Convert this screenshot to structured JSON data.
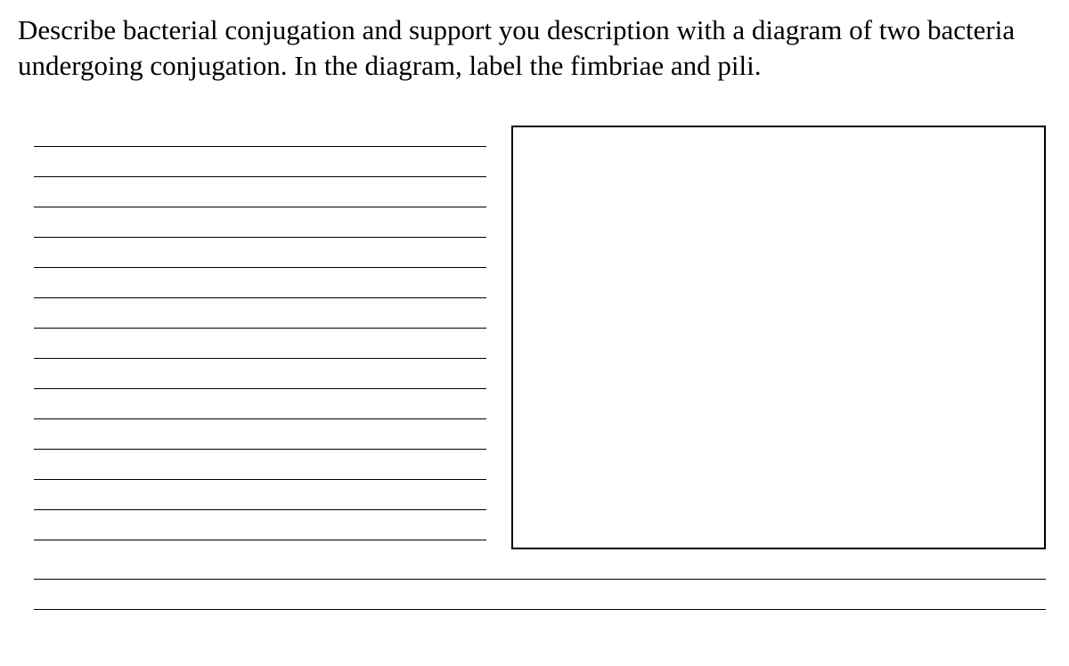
{
  "question": {
    "prompt": "Describe bacterial conjugation and support you description with a diagram of two bacteria undergoing conjugation. In the diagram, label the fimbriae and pili."
  },
  "layout": {
    "left_line_count": 14,
    "bottom_line_count": 2
  }
}
